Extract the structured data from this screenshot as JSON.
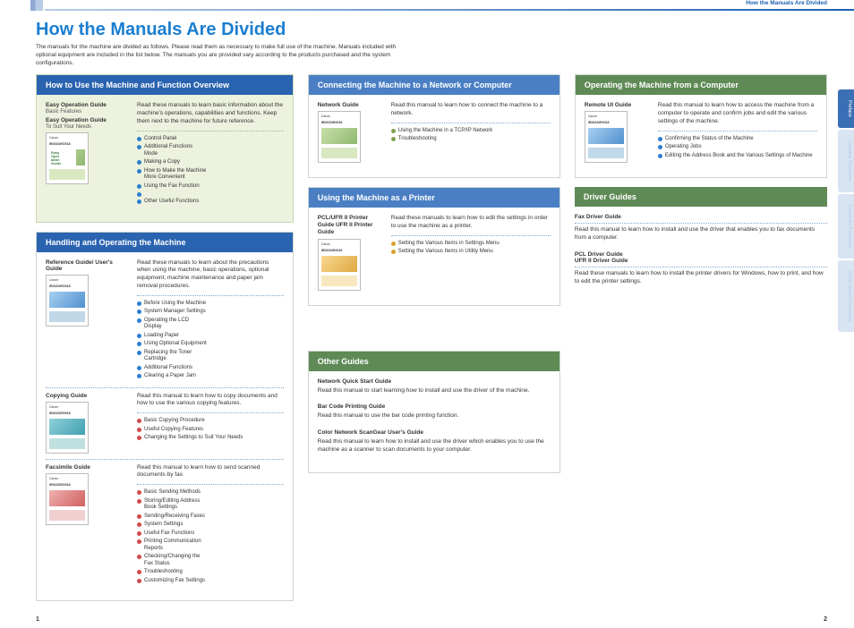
{
  "crumb": "How the Manuals Are Divided",
  "title": "How the Manuals Are Divided",
  "intro": "The manuals for the machine are divided as follows. Please read them as necessary to make full use of the machine. Manuals included with optional equipment are included in the list below. The manuals you are provided vary according to the products purchased and the system configurations.",
  "pgl": "1",
  "pgr": "2",
  "tabs": [
    "Preface",
    "Copying Functions",
    "Facsimile Functions",
    "Other Useful Functions"
  ],
  "s1": {
    "title": "How to Use the Machine and Function Overview",
    "g1": "Easy Operation Guide",
    "g1s": "Basic Features",
    "g2": "Easy Operation Guide",
    "g2s": "To Suit Your Needs",
    "desc": "Read these manuals to learn basic information about the machine's operations, capabilities and functions. Keep them next to the machine for future reference.",
    "b": [
      "Control Panel",
      "Additional Functions Mode",
      "Making a Copy",
      "How to Make the Machine More Convenient",
      "Using the Fax Function",
      "Other Useful Functions"
    ]
  },
  "s2": {
    "title": "Handling and Operating the Machine",
    "r1": {
      "g": "Reference Guide/ User's Guide",
      "desc": "Read these manuals to learn about the precautions when using the machine, basic operations, optional equipment, machine maintenance and paper jam removal procedures.",
      "b": [
        "Before Using the Machine",
        "System Manager Settings",
        "Operating the LCD Display",
        "Loading Paper",
        "Using Optional Equipment",
        "Replacing the Toner Cartridge",
        "Additional Functions",
        "Clearing a Paper Jam"
      ]
    },
    "r2": {
      "g": "Copying Guide",
      "desc": "Read this manual to learn how to copy documents and how to use the various copying features.",
      "b": [
        "Basic Copying Procedure",
        "Useful Copying Features",
        "Changing the Settings to Suit Your Needs"
      ]
    },
    "r3": {
      "g": "Facsimile Guide",
      "desc": "Read this manual to learn how to send scanned documents by fax.",
      "b": [
        "Basic Sending Methods",
        "Storing/Editing Address Book Settings",
        "Sending/Receiving Faxes",
        "System Settings",
        "Useful Fax Functions",
        "Printing Communication Reports",
        "Checking/Changing the Fax Status",
        "Troubleshooting",
        "Customizing Fax Settings"
      ]
    }
  },
  "s3": {
    "title": "Connecting the Machine to a Network or Computer",
    "g": "Network Guide",
    "desc": "Read this manual to learn how to connect the machine to a network.",
    "b": [
      "Using the Machine in a TCP/IP Network",
      "Troubleshooting"
    ]
  },
  "s4": {
    "title": "Operating the Machine from a Computer",
    "g": "Remote UI Guide",
    "desc": "Read this manual to learn how to access the machine from a computer to operate and confirm jobs and edit the various settings of the machine.",
    "b": [
      "Confirming the Status of the Machine",
      "Operating Jobs",
      "Editing the Address Book and the Various Settings of Machine"
    ]
  },
  "s5": {
    "title": "Using the Machine as a Printer",
    "g": "PCL/UFR II Printer Guide UFR II Printer Guide",
    "desc": "Read these manuals to learn how to edit the settings in order to use the machine as a printer.",
    "b": [
      "Setting the Various Items in Settings Menu",
      "Setting the Various Items in Utility Menu"
    ]
  },
  "s6": {
    "title": "Driver Guides",
    "g1": "Fax Driver Guide",
    "d1": "Read this manual to learn how to install and use the driver that enables you to fax documents from a computer.",
    "g2": "PCL Driver Guide\nUFR II Driver Guide",
    "d2": "Read these manuals to learn how to install the printer drivers for Windows, how to print, and how to edit the printer settings."
  },
  "s7": {
    "title": "Other Guides",
    "g1": "Network Quick Start Guide",
    "d1": "Read this manual to start learning how to install and use the driver of the machine.",
    "g2": "Bar Code Printing Guide",
    "d2": "Read this manual to use the bar code printing function.",
    "g3": "Color Network ScanGear User's Guide",
    "d3": "Read this manual to learn how to install and use the driver which enables you to use the machine as a scanner to scan documents to your computer."
  },
  "logo": "Canon",
  "model": "iR2022/iR2018"
}
